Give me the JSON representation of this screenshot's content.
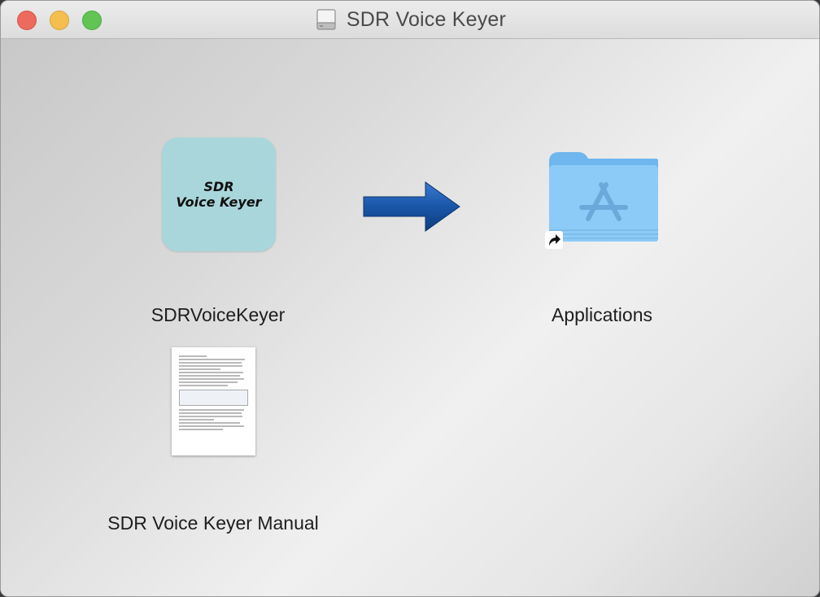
{
  "window": {
    "title": "SDR Voice Keyer",
    "title_icon": "external-disk-icon"
  },
  "traffic_lights": {
    "close_color": "#ed6a5e",
    "minimize_color": "#f5bf4f",
    "maximize_color": "#61c554"
  },
  "items": {
    "app": {
      "label": "SDRVoiceKeyer",
      "icon_text_line1": "SDR",
      "icon_text_line2": "Voice Keyer",
      "icon_color": "#a9d6db"
    },
    "arrow": {
      "icon": "install-arrow-icon",
      "color": "#1a56a8"
    },
    "applications": {
      "label": "Applications",
      "icon": "applications-folder-icon",
      "alias_badge": "alias-arrow-icon"
    },
    "manual": {
      "label": "SDR Voice Keyer Manual",
      "icon": "document-thumbnail-icon"
    }
  }
}
